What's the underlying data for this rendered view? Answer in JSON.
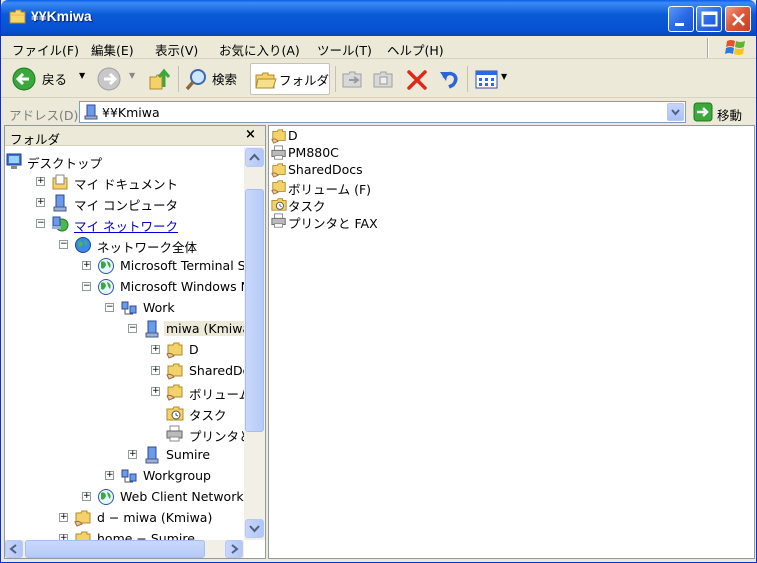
{
  "window": {
    "title": "¥¥Kmiwa"
  },
  "menu": [
    "ファイル(F)",
    "編集(E)",
    "表示(V)",
    "お気に入り(A)",
    "ツール(T)",
    "ヘルプ(H)"
  ],
  "toolbar": {
    "back_label": "戻る",
    "search_label": "検索",
    "folders_label": "フォルダ"
  },
  "address": {
    "label": "アドレス(D)",
    "value": "¥¥Kmiwa",
    "go_label": "移動"
  },
  "folder_pane": {
    "title": "フォルダ",
    "close": "×"
  },
  "tree": [
    {
      "label": "デスクトップ",
      "icon": "desktop-icon",
      "toggle": ""
    },
    {
      "label": "マイ ドキュメント",
      "icon": "my-documents-icon",
      "toggle": "+"
    },
    {
      "label": "マイ コンピュータ",
      "icon": "my-computer-icon",
      "toggle": "+"
    },
    {
      "label": "マイ ネットワーク",
      "icon": "my-network-icon",
      "toggle": "−"
    },
    {
      "label": "ネットワーク全体",
      "icon": "globe-icon",
      "toggle": "−"
    },
    {
      "label": "Microsoft Terminal Se",
      "icon": "network-globe-icon",
      "toggle": "+"
    },
    {
      "label": "Microsoft Windows Ne",
      "icon": "network-globe-icon",
      "toggle": "−"
    },
    {
      "label": "Work",
      "icon": "workgroup-icon",
      "toggle": "−"
    },
    {
      "label": "miwa (Kmiwa)",
      "icon": "computer-icon",
      "toggle": "−"
    },
    {
      "label": "D",
      "icon": "shared-folder-icon",
      "toggle": "+"
    },
    {
      "label": "SharedDocs",
      "icon": "shared-folder-icon",
      "toggle": "+"
    },
    {
      "label": "ボリューム (F",
      "icon": "shared-folder-icon",
      "toggle": "+"
    },
    {
      "label": "タスク",
      "icon": "scheduled-tasks-icon",
      "toggle": ""
    },
    {
      "label": "プリンタと FA",
      "icon": "printer-icon",
      "toggle": ""
    },
    {
      "label": "Sumire",
      "icon": "computer-icon",
      "toggle": "+"
    },
    {
      "label": "Workgroup",
      "icon": "workgroup-icon",
      "toggle": "+"
    },
    {
      "label": "Web Client Network",
      "icon": "network-globe-icon",
      "toggle": "+"
    },
    {
      "label": "d − miwa (Kmiwa)",
      "icon": "shared-folder-icon",
      "toggle": "+"
    },
    {
      "label": "home − Sumire",
      "icon": "shared-folder-icon",
      "toggle": "+"
    }
  ],
  "files": [
    {
      "label": "D",
      "icon": "shared-folder-icon"
    },
    {
      "label": "PM880C",
      "icon": "printer-icon"
    },
    {
      "label": "SharedDocs",
      "icon": "shared-folder-icon"
    },
    {
      "label": "ボリューム (F)",
      "icon": "shared-folder-icon"
    },
    {
      "label": "タスク",
      "icon": "scheduled-tasks-icon"
    },
    {
      "label": "プリンタと FAX",
      "icon": "printer-icon"
    }
  ]
}
